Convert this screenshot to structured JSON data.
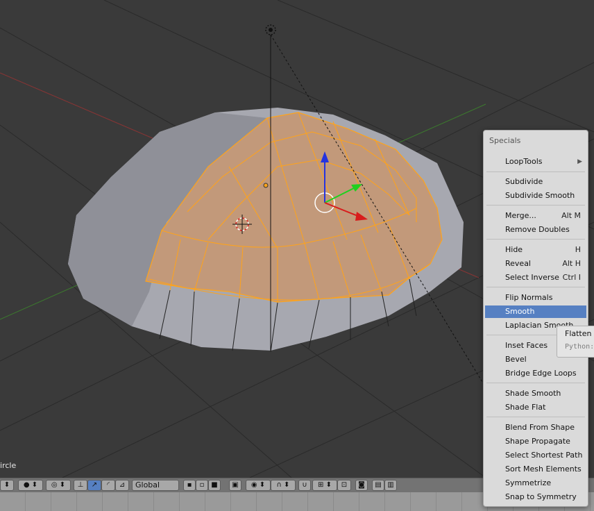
{
  "viewport": {
    "object_label": "ircle"
  },
  "header": {
    "orientation_value": "Global"
  },
  "menu": {
    "title": "Specials",
    "items": [
      {
        "label": "LoopTools",
        "shortcut": "",
        "submenu": true
      },
      {
        "label": "Subdivide",
        "shortcut": ""
      },
      {
        "label": "Subdivide Smooth",
        "shortcut": ""
      },
      {
        "label": "Merge...",
        "shortcut": "Alt M"
      },
      {
        "label": "Remove Doubles",
        "shortcut": ""
      },
      {
        "label": "Hide",
        "shortcut": "H"
      },
      {
        "label": "Reveal",
        "shortcut": "Alt H"
      },
      {
        "label": "Select Inverse",
        "shortcut": "Ctrl I"
      },
      {
        "label": "Flip Normals",
        "shortcut": ""
      },
      {
        "label": "Smooth",
        "shortcut": "",
        "highlighted": true
      },
      {
        "label": "Laplacian Smooth",
        "shortcut": ""
      },
      {
        "label": "Inset Faces",
        "shortcut": ""
      },
      {
        "label": "Bevel",
        "shortcut": ""
      },
      {
        "label": "Bridge Edge Loops",
        "shortcut": ""
      },
      {
        "label": "Shade Smooth",
        "shortcut": ""
      },
      {
        "label": "Shade Flat",
        "shortcut": ""
      },
      {
        "label": "Blend From Shape",
        "shortcut": ""
      },
      {
        "label": "Shape Propagate",
        "shortcut": ""
      },
      {
        "label": "Select Shortest Path",
        "shortcut": ""
      },
      {
        "label": "Sort Mesh Elements",
        "shortcut": ""
      },
      {
        "label": "Symmetrize",
        "shortcut": ""
      },
      {
        "label": "Snap to Symmetry",
        "shortcut": ""
      }
    ]
  },
  "tooltip": {
    "line1": "Flatten a",
    "line2": "Python:"
  },
  "colors": {
    "menu_highlight": "#5680c2",
    "selection_orange": "#ffa31a"
  }
}
